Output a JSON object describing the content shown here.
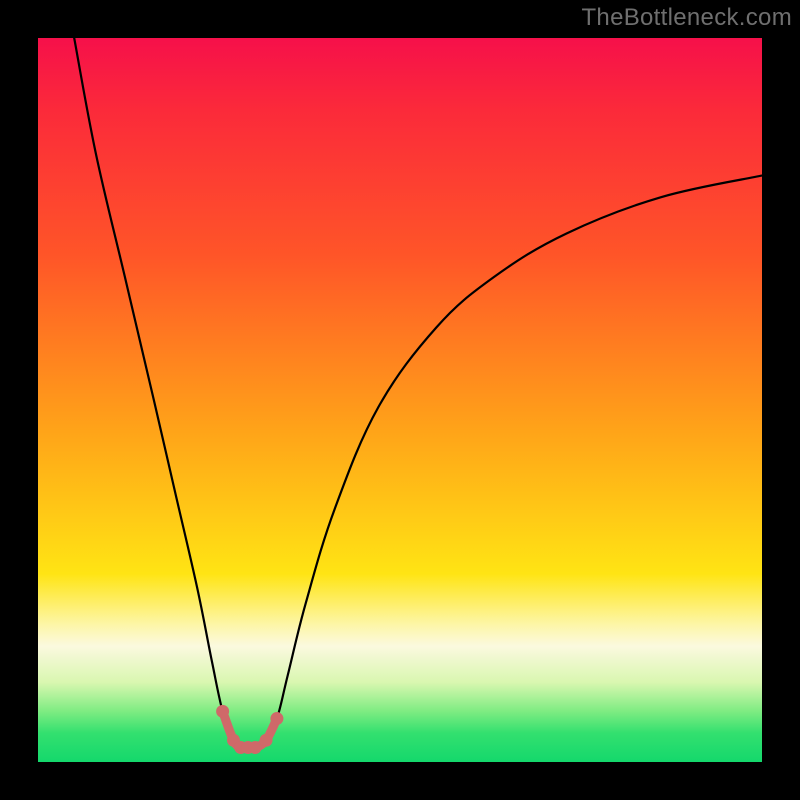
{
  "watermark": "TheBottleneck.com",
  "chart_data": {
    "type": "line",
    "title": "",
    "xlabel": "",
    "ylabel": "",
    "xlim": [
      0,
      100
    ],
    "ylim": [
      0,
      100
    ],
    "grid": false,
    "legend": false,
    "series": [
      {
        "name": "bottleneck-curve",
        "x": [
          5,
          8,
          12,
          16,
          19,
          22,
          24,
          25.5,
          27,
          28,
          29,
          30,
          31.5,
          33,
          34.5,
          37,
          41,
          47,
          55,
          63,
          73,
          86,
          100
        ],
        "y": [
          100,
          84,
          67,
          50,
          37,
          24,
          14,
          7,
          3,
          2,
          2,
          2,
          3,
          6,
          12,
          22,
          35,
          49,
          60,
          67,
          73,
          78,
          81
        ]
      },
      {
        "name": "trough-markers",
        "x": [
          25.5,
          27,
          28,
          29,
          30,
          31.5,
          33
        ],
        "y": [
          7,
          3,
          2,
          2,
          2,
          3,
          6
        ]
      }
    ],
    "colors": {
      "curve": "#000000",
      "markers": "#cf6969"
    }
  }
}
